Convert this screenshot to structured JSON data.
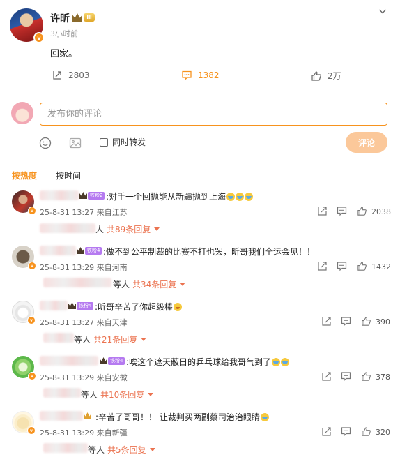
{
  "post": {
    "author": "许昕",
    "level_badge": "Ⅲ",
    "time": "3小时前",
    "text": "回家。",
    "actions": {
      "repost_count": "2803",
      "comment_count": "1382",
      "like_count": "2万"
    }
  },
  "composer": {
    "placeholder": "发布你的评论",
    "repost_label": "同时转发",
    "submit_label": "评论"
  },
  "sort_tabs": [
    "按热度",
    "按时间"
  ],
  "comments": [
    {
      "fan_label": "铁粉2",
      "text": ":对手一个回抛能从新疆抛到上海",
      "emojis": [
        "cry",
        "cry",
        "cry"
      ],
      "time": "25-8-31 13:27",
      "location": "来自江苏",
      "likes": "2038",
      "reply_who": "人",
      "reply_count": "共89条回复"
    },
    {
      "fan_label": "铁粉4",
      "text": ":做不到公平制裁的比赛不打也罢，昕哥我们全运会见！！",
      "emojis": [],
      "time": "25-8-31 13:29",
      "location": "来自河南",
      "likes": "1432",
      "reply_who": "等人",
      "reply_count": "共34条回复"
    },
    {
      "fan_label": "铁粉4",
      "text": ":昕哥辛苦了你超级棒",
      "emojis": [
        "hug"
      ],
      "time": "25-8-31 13:27",
      "location": "来自天津",
      "likes": "390",
      "reply_who": "等人",
      "reply_count": "共21条回复"
    },
    {
      "fan_label": "铁粉4",
      "text": ":唉这个遮天蔽日的乒乓球给我哥气到了",
      "emojis": [
        "cry",
        "cry"
      ],
      "time": "25-8-31 13:29",
      "location": "来自安徽",
      "likes": "378",
      "reply_who": "等人",
      "reply_count": "共10条回复"
    },
    {
      "fan_label": "",
      "text": ":辛苦了哥哥！！ 让裁判买两副蔡司治治眼睛",
      "emojis": [
        "cry"
      ],
      "time": "25-8-31 13:29",
      "location": "来自新疆",
      "likes": "320",
      "reply_who": "等人",
      "reply_count": "共5条回复"
    }
  ],
  "colors": {
    "accent": "#f7931e",
    "reply_link": "#eb7350",
    "submit_disabled": "#fbc89a",
    "fan_badge": "#b57af0"
  },
  "icons": [
    "chevron-down-icon",
    "repost-icon",
    "comment-icon",
    "like-icon",
    "emoji-icon",
    "image-icon",
    "share-icon",
    "reply-icon",
    "vip-badge-icon",
    "crown-icon"
  ]
}
